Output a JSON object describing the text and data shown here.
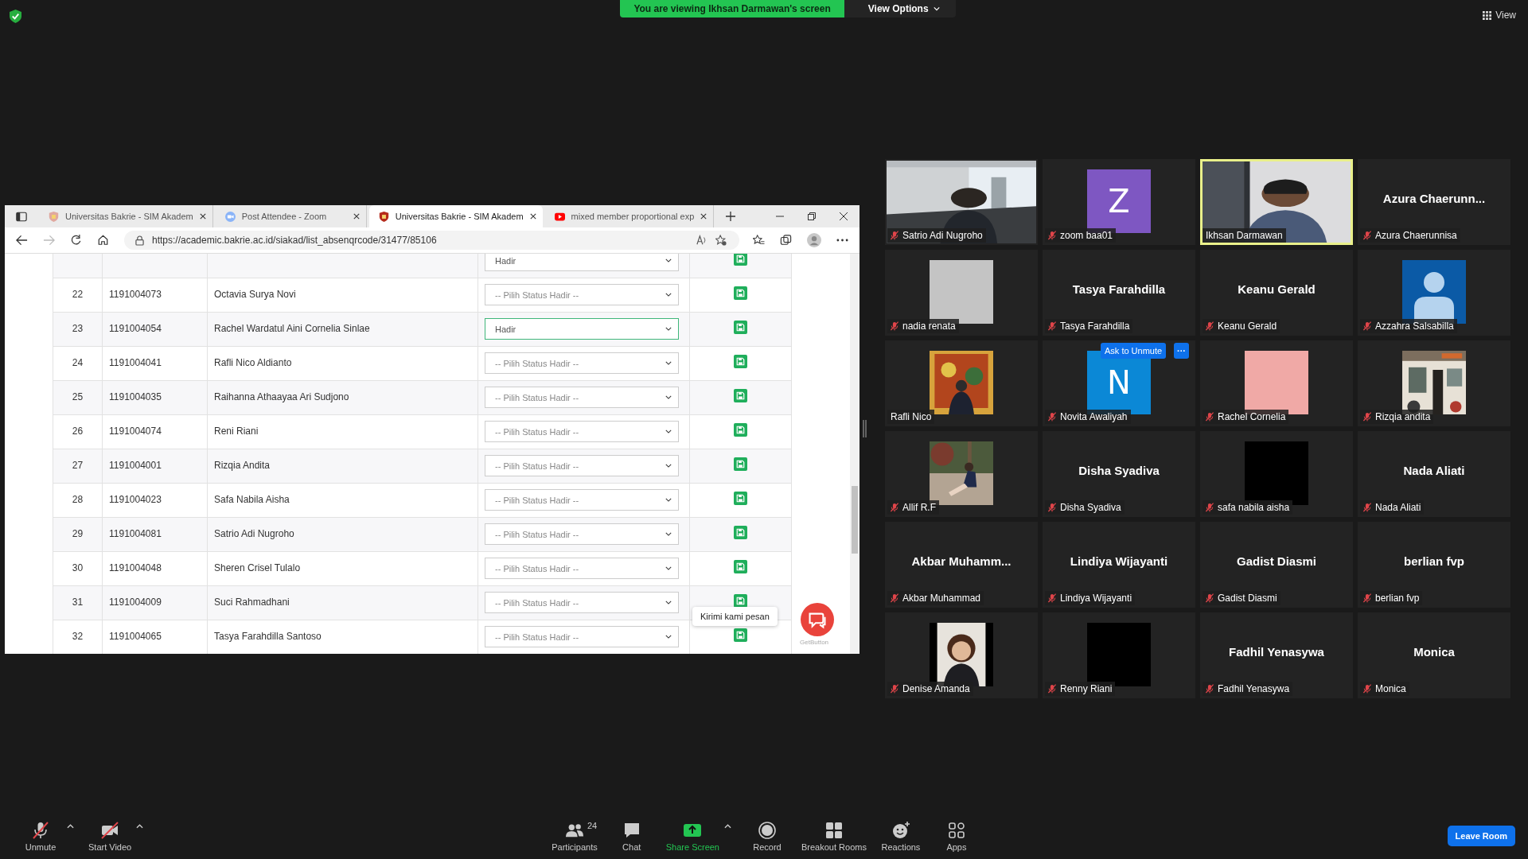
{
  "top_bar": {
    "banner": "You are viewing Ikhsan Darmawan's screen",
    "view_options": "View Options",
    "view": "View"
  },
  "browser": {
    "tabs": [
      {
        "title": "Universitas Bakrie - SIM Akadem",
        "kind": "site",
        "selected": false
      },
      {
        "title": "Post Attendee - Zoom",
        "kind": "meeting",
        "selected": false
      },
      {
        "title": "Universitas Bakrie - SIM Akadem",
        "kind": "site",
        "selected": true
      },
      {
        "title": "mixed member proportional exp",
        "kind": "video",
        "selected": false
      }
    ],
    "url": "https://academic.bakrie.ac.id/siakad/list_absenqrcode/31477/85106",
    "rows": [
      {
        "status": "Hadir",
        "focused": false
      },
      {
        "number": "22",
        "nim": "1191004073",
        "name": "Octavia Surya Novi",
        "placeholder": "-- Pilih Status Hadir --",
        "focused": false
      },
      {
        "number": "23",
        "nim": "1191004054",
        "name": "Rachel Wardatul Aini Cornelia Sinlae",
        "status": "Hadir",
        "focused": true
      },
      {
        "number": "24",
        "nim": "1191004041",
        "name": "Rafli Nico Aldianto",
        "placeholder": "-- Pilih Status Hadir --",
        "focused": false
      },
      {
        "number": "25",
        "nim": "1191004035",
        "name": "Raihanna Athaayaa Ari Sudjono",
        "placeholder": "-- Pilih Status Hadir --",
        "focused": false
      },
      {
        "number": "26",
        "nim": "1191004074",
        "name": "Reni Riani",
        "placeholder": "-- Pilih Status Hadir --",
        "focused": false
      },
      {
        "number": "27",
        "nim": "1191004001",
        "name": "Rizqia Andita",
        "placeholder": "-- Pilih Status Hadir --",
        "focused": false
      },
      {
        "number": "28",
        "nim": "1191004023",
        "name": "Safa Nabila Aisha",
        "placeholder": "-- Pilih Status Hadir --",
        "focused": false
      },
      {
        "number": "29",
        "nim": "1191004081",
        "name": "Satrio Adi Nugroho",
        "placeholder": "-- Pilih Status Hadir --",
        "focused": false
      },
      {
        "number": "30",
        "nim": "1191004048",
        "name": "Sheren Crisel Tulalo",
        "placeholder": "-- Pilih Status Hadir --",
        "focused": false
      },
      {
        "number": "31",
        "nim": "1191004009",
        "name": "Suci Rahmadhani",
        "placeholder": "-- Pilih Status Hadir --",
        "focused": false
      },
      {
        "number": "32",
        "nim": "1191004065",
        "name": "Tasya Farahdilla Santoso",
        "placeholder": "-- Pilih Status Hadir --",
        "focused": false
      }
    ],
    "chat_widget": {
      "message": "Kirimi kami pesan",
      "brand": "GetButton"
    }
  },
  "participants": [
    {
      "name": "Satrio Adi Nugroho",
      "kind": "video",
      "muted": true,
      "speaking": false
    },
    {
      "name": "zoom baa01",
      "kind": "letter",
      "letter": "Z",
      "color": "#7e57c2",
      "muted": true,
      "speaking": false
    },
    {
      "name": "Ikhsan Darmawan",
      "kind": "video",
      "muted": false,
      "speaking": true
    },
    {
      "name": "Azura Chaerunnisa",
      "kind": "name",
      "display": "Azura Chaerunn...",
      "muted": true,
      "speaking": false
    },
    {
      "name": "nadia renata",
      "kind": "blank",
      "color": "#c4c4c4",
      "muted": true,
      "speaking": false
    },
    {
      "name": "Tasya Farahdilla",
      "kind": "name",
      "display": "Tasya Farahdilla",
      "muted": true,
      "speaking": false
    },
    {
      "name": "Keanu Gerald",
      "kind": "name",
      "display": "Keanu Gerald",
      "muted": true,
      "speaking": false
    },
    {
      "name": "Azzahra Salsabilla",
      "kind": "avatar",
      "color": "#0b5aa6",
      "muted": true,
      "speaking": false
    },
    {
      "name": "Rafli Nico",
      "muted": false,
      "speaking": false
    },
    {
      "name": "Novita Awaliyah",
      "kind": "letter",
      "letter": "N",
      "color": "#0b88d6",
      "muted": true,
      "speaking": false,
      "actions": {
        "ask": "Ask to Unmute",
        "more": "···"
      }
    },
    {
      "name": "Rachel Cornelia",
      "kind": "blank",
      "color": "#f0a9a6",
      "muted": true,
      "speaking": false
    },
    {
      "name": "Rizqia andita",
      "muted": true,
      "speaking": false
    },
    {
      "name": "Allif R.F",
      "muted": true,
      "speaking": false
    },
    {
      "name": "Disha Syadiva",
      "kind": "name",
      "display": "Disha Syadiva",
      "muted": true,
      "speaking": false
    },
    {
      "name": "safa nabila aisha",
      "kind": "blank",
      "color": "#000000",
      "muted": true,
      "speaking": false
    },
    {
      "name": "Nada Aliati",
      "kind": "name",
      "display": "Nada Aliati",
      "muted": true,
      "speaking": false
    },
    {
      "name": "Akbar Muhammad",
      "kind": "name",
      "display": "Akbar Muhamm...",
      "muted": true,
      "speaking": false
    },
    {
      "name": "Lindiya Wijayanti",
      "kind": "name",
      "display": "Lindiya Wijayanti",
      "muted": true,
      "speaking": false
    },
    {
      "name": "Gadist Diasmi",
      "kind": "name",
      "display": "Gadist Diasmi",
      "muted": true,
      "speaking": false
    },
    {
      "name": "berlian fvp",
      "kind": "name",
      "display": "berlian fvp",
      "muted": true,
      "speaking": false
    },
    {
      "name": "Denise Amanda",
      "muted": true,
      "speaking": false
    },
    {
      "name": "Renny Riani",
      "kind": "blank",
      "color": "#000000",
      "muted": true,
      "speaking": false
    },
    {
      "name": "Fadhil Yenasywa",
      "kind": "name",
      "display": "Fadhil Yenasywa",
      "muted": true,
      "speaking": false
    },
    {
      "name": "Monica",
      "kind": "name",
      "display": "Monica",
      "muted": true,
      "speaking": false
    }
  ],
  "toolbar": {
    "left": [
      {
        "label": "Unmute",
        "kind": "mic",
        "off": true,
        "menu": true
      },
      {
        "label": "Start Video",
        "kind": "camera",
        "off": true,
        "menu": true
      }
    ],
    "center": [
      {
        "label": "Participants",
        "kind": "participants",
        "count": "24",
        "menu": false
      },
      {
        "label": "Chat",
        "kind": "chat",
        "menu": false
      },
      {
        "label": "Share Screen",
        "kind": "share",
        "menu": true
      },
      {
        "label": "Record",
        "kind": "record",
        "menu": false
      },
      {
        "label": "Breakout Rooms",
        "kind": "breakout",
        "menu": false
      },
      {
        "label": "Reactions",
        "kind": "reactions",
        "menu": false
      },
      {
        "label": "Apps",
        "kind": "apps",
        "menu": false
      }
    ],
    "leave": "Leave Room"
  }
}
